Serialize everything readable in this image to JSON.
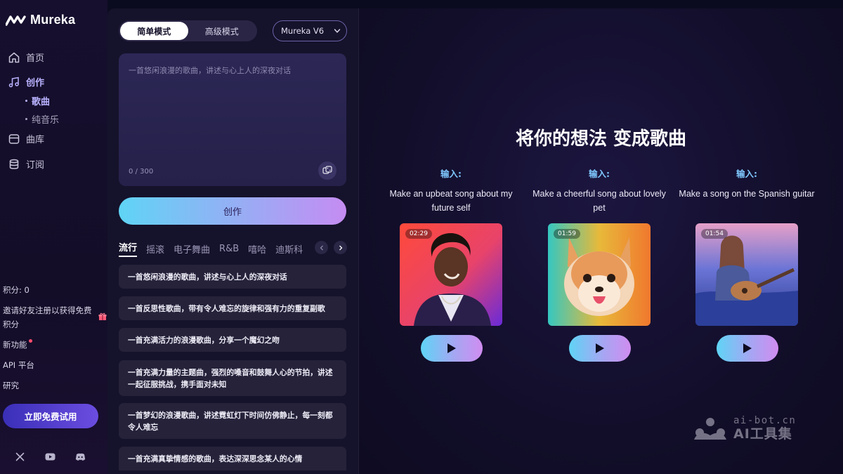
{
  "sidebar": {
    "brand": "Mureka",
    "nav": [
      {
        "label": "首页",
        "icon": "home-icon"
      },
      {
        "label": "创作",
        "icon": "music-note-icon",
        "active": true
      },
      {
        "label": "曲库",
        "icon": "library-icon"
      },
      {
        "label": "订阅",
        "icon": "subscription-icon"
      }
    ],
    "sub_items": [
      {
        "label": "歌曲",
        "active": true
      },
      {
        "label": "纯音乐"
      }
    ],
    "credits": "积分: 0",
    "invite": "邀请好友注册以获得免费积分",
    "new_features": "新功能",
    "api": "API 平台",
    "research": "研究",
    "trial_button": "立即免费试用",
    "socials": [
      "x-icon",
      "youtube-icon",
      "discord-icon"
    ]
  },
  "composer": {
    "modes": [
      "简单模式",
      "高级模式"
    ],
    "selected_mode": "简单模式",
    "version": "Mureka V6",
    "prompt_placeholder": "一首悠闲浪漫的歌曲，讲述与心上人的深夜对话",
    "counter": "0 / 300",
    "create_button": "创作",
    "genres": [
      "流行",
      "摇滚",
      "电子舞曲",
      "R&B",
      "嘻哈",
      "迪斯科"
    ],
    "selected_genre": "流行",
    "ideas": [
      "一首悠闲浪漫的歌曲，讲述与心上人的深夜对话",
      "一首反思性歌曲，带有令人难忘的旋律和强有力的重复副歌",
      "一首充满活力的浪漫歌曲，分享一个魔幻之吻",
      "一首充满力量的主题曲，强烈的嗓音和鼓舞人心的节拍，讲述一起征服挑战，携手面对未知",
      "一首梦幻的浪漫歌曲，讲述霓虹灯下时间仿佛静止，每一刻都令人难忘",
      "一首充满真挚情感的歌曲，表达深深思念某人的心情"
    ]
  },
  "showcase": {
    "headline": "将你的想法 变成歌曲",
    "examples": [
      {
        "label": "输入:",
        "text": "Make an upbeat song about my future self",
        "duration": "02:29"
      },
      {
        "label": "输入:",
        "text": "Make a cheerful song about lovely pet",
        "duration": "01:59"
      },
      {
        "label": "输入:",
        "text": "Make a song on the Spanish guitar",
        "duration": "01:54"
      }
    ]
  },
  "watermark": {
    "url": "ai-bot.cn",
    "name": "AI工具集"
  },
  "colors": {
    "accent": "#b9b2ff",
    "cyan": "#5fd4f5",
    "purple": "#c58cf2",
    "background": "#0b0b1f"
  }
}
